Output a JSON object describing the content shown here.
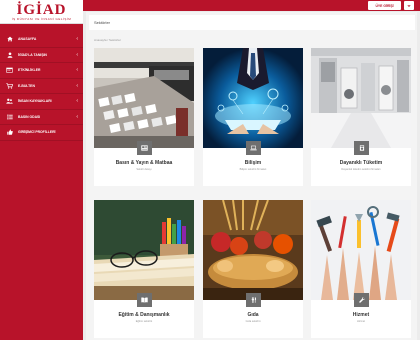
{
  "brand": {
    "logo": "İGİAD",
    "tagline": "İŞ DÜNYASI VE İNSANİ GELİŞİM",
    "primary_color": "#b8132a"
  },
  "sidebar": {
    "items": [
      {
        "label": "ANASAYFA",
        "icon": "home-icon",
        "has_chevron": true
      },
      {
        "label": "İGİAD'LA TANIŞIN",
        "icon": "user-icon",
        "has_chevron": true
      },
      {
        "label": "ETKİNLİKLER",
        "icon": "calendar-icon",
        "has_chevron": true
      },
      {
        "label": "E-BÜLTEN",
        "icon": "cart-icon",
        "has_chevron": true
      },
      {
        "label": "İNSAN KAYNAKLARI",
        "icon": "users-icon",
        "has_chevron": true
      },
      {
        "label": "BASIN ODASI",
        "icon": "list-icon",
        "has_chevron": true
      },
      {
        "label": "GİRİŞİMCİ PROFİLLERİ",
        "icon": "thumbs-up-icon",
        "has_chevron": false
      }
    ]
  },
  "topbar": {
    "login_label": "ÜYE GİRİŞİ"
  },
  "page": {
    "title": "Sektörler",
    "breadcrumb": "Anasayfa / Sektörler"
  },
  "cards": [
    {
      "title": "Basın & Yayın & Matbaa",
      "sub": "Sektör detayı"
    },
    {
      "title": "Bilişim",
      "sub": "Bilişim sektörü firmaları"
    },
    {
      "title": "Dayanıklı Tüketim",
      "sub": "Dayanıklı tüketim sektörü firmaları"
    },
    {
      "title": "Eğitim & Danışmanlık",
      "sub": "Eğitim sektörü"
    },
    {
      "title": "Gıda",
      "sub": "Gıda sektörü"
    },
    {
      "title": "Hizmet",
      "sub": "Hizmet"
    }
  ]
}
